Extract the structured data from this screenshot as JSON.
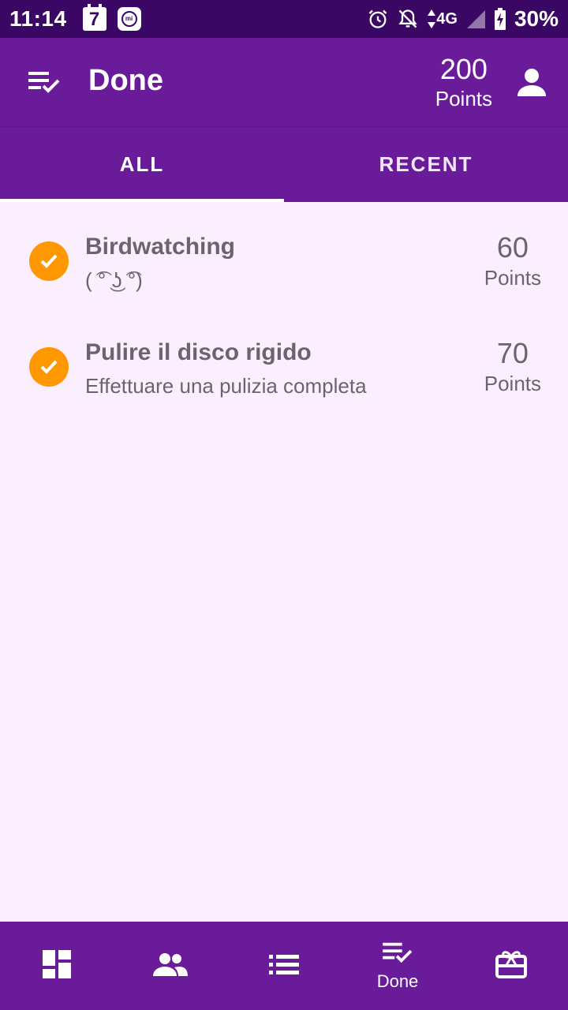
{
  "status_bar": {
    "time": "11:14",
    "calendar_day": "7",
    "mi_label": "mi",
    "network": "4G",
    "battery": "30%"
  },
  "app_bar": {
    "title": "Done",
    "points_value": "200",
    "points_label": "Points",
    "menu_icon": "playlist-check-icon",
    "account_icon": "person-icon"
  },
  "tabs": [
    {
      "label": "ALL",
      "selected": true
    },
    {
      "label": "RECENT",
      "selected": false
    }
  ],
  "tasks": [
    {
      "title": "Birdwatching",
      "description": "( ͡° ͜ʖ ͡°)",
      "points": "60",
      "points_label": "Points",
      "icon": "check-circle-icon"
    },
    {
      "title": "Pulire il disco rigido",
      "description": "Effettuare una pulizia completa",
      "points": "70",
      "points_label": "Points",
      "icon": "check-circle-icon"
    }
  ],
  "bottom_nav": [
    {
      "icon": "dashboard-icon",
      "label": ""
    },
    {
      "icon": "group-icon",
      "label": ""
    },
    {
      "icon": "list-icon",
      "label": ""
    },
    {
      "icon": "playlist-check-icon",
      "label": "Done",
      "selected": true
    },
    {
      "icon": "gift-card-icon",
      "label": ""
    }
  ],
  "colors": {
    "primary": "#6a1b9a",
    "status_bar": "#3b0764",
    "background": "#fbeffd",
    "accent": "#ff9800",
    "text_secondary": "#6b6470"
  }
}
